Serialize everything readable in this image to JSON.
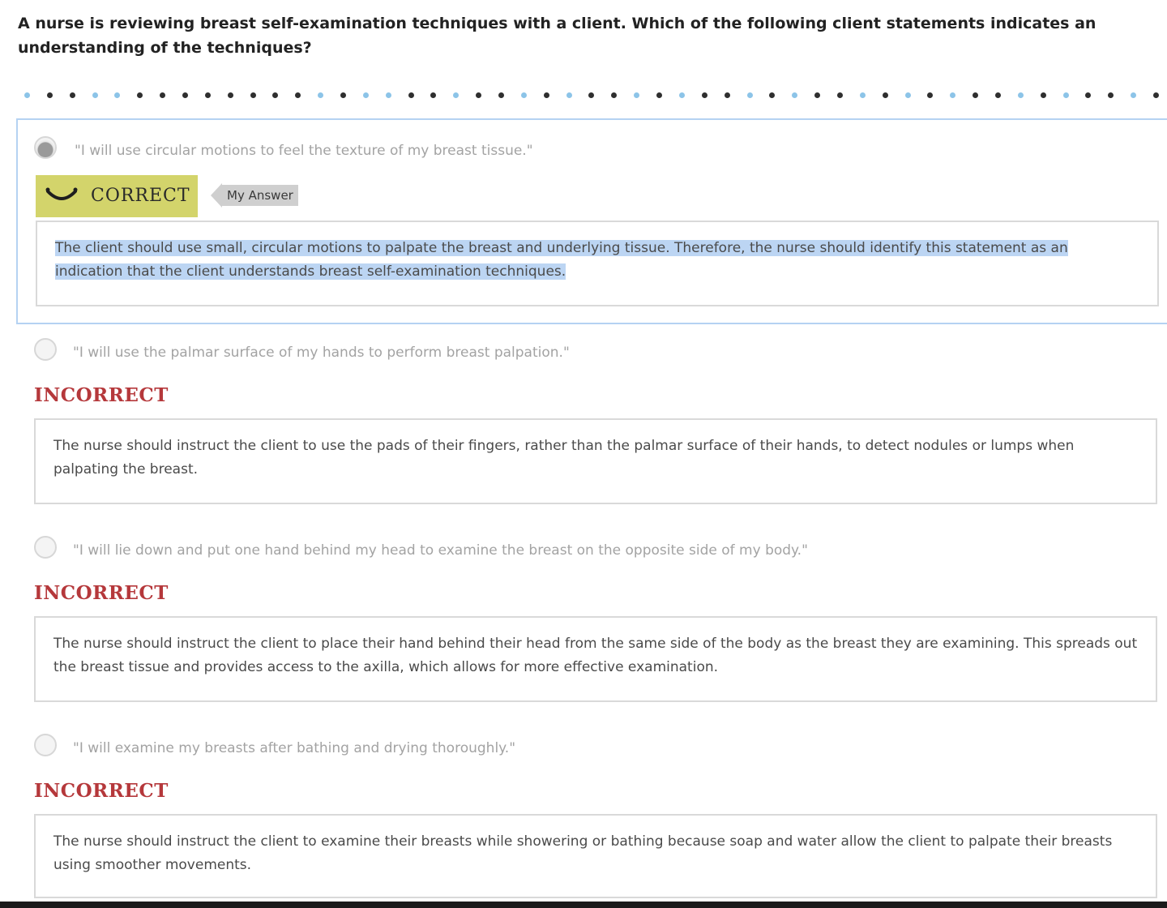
{
  "question": "A nurse is reviewing breast self-examination techniques with a client. Which of the following client statements indicates an understanding of the techniques?",
  "progress_dots": [
    "blue",
    "dark",
    "dark",
    "blue",
    "blue",
    "dark",
    "dark",
    "dark",
    "dark",
    "dark",
    "dark",
    "dark",
    "dark",
    "blue",
    "dark",
    "blue",
    "blue",
    "dark",
    "dark",
    "blue",
    "dark",
    "dark",
    "blue",
    "dark",
    "blue",
    "dark",
    "dark",
    "blue",
    "dark",
    "blue",
    "dark",
    "dark",
    "blue",
    "dark",
    "blue",
    "dark",
    "dark",
    "blue",
    "dark",
    "blue",
    "dark",
    "blue",
    "dark",
    "dark",
    "blue",
    "dark",
    "blue",
    "dark",
    "dark",
    "blue",
    "dark"
  ],
  "options": [
    {
      "text": "\"I will use circular motions to feel the texture of my breast tissue.\"",
      "selected": true,
      "result": "CORRECT",
      "my_answer_label": "My Answer",
      "feedback": "The client should use small, circular motions to palpate the breast and underlying tissue. Therefore, the nurse should identify this statement as an indication that the client understands breast self-examination techniques."
    },
    {
      "text": "\"I will use the palmar surface of my hands to perform breast palpation.\"",
      "selected": false,
      "result": "INCORRECT",
      "feedback": "The nurse should instruct the client to use the pads of their fingers, rather than the palmar surface of their hands, to detect nodules or lumps when palpating the breast."
    },
    {
      "text": "\"I will lie down and put one hand behind my head to examine the breast on the opposite side of my body.\"",
      "selected": false,
      "result": "INCORRECT",
      "feedback": "The nurse should instruct the client to place their hand behind their head from the same side of the body as the breast they are examining. This spreads out the breast tissue and provides access to the axilla, which allows for more effective examination."
    },
    {
      "text": "\"I will examine my breasts after bathing and drying thoroughly.\"",
      "selected": false,
      "result": "INCORRECT",
      "feedback": "The nurse should instruct the client to examine their breasts while showering or bathing because soap and water allow the client to palpate their breasts using smoother movements."
    }
  ],
  "colors": {
    "correct_badge": "#d3d46b",
    "incorrect_text": "#b5383b",
    "selection_highlight": "#bcd5f3",
    "selected_border": "#b5d2f2",
    "dot_blue": "#8cc4e8",
    "dot_dark": "#2f2f2f"
  }
}
